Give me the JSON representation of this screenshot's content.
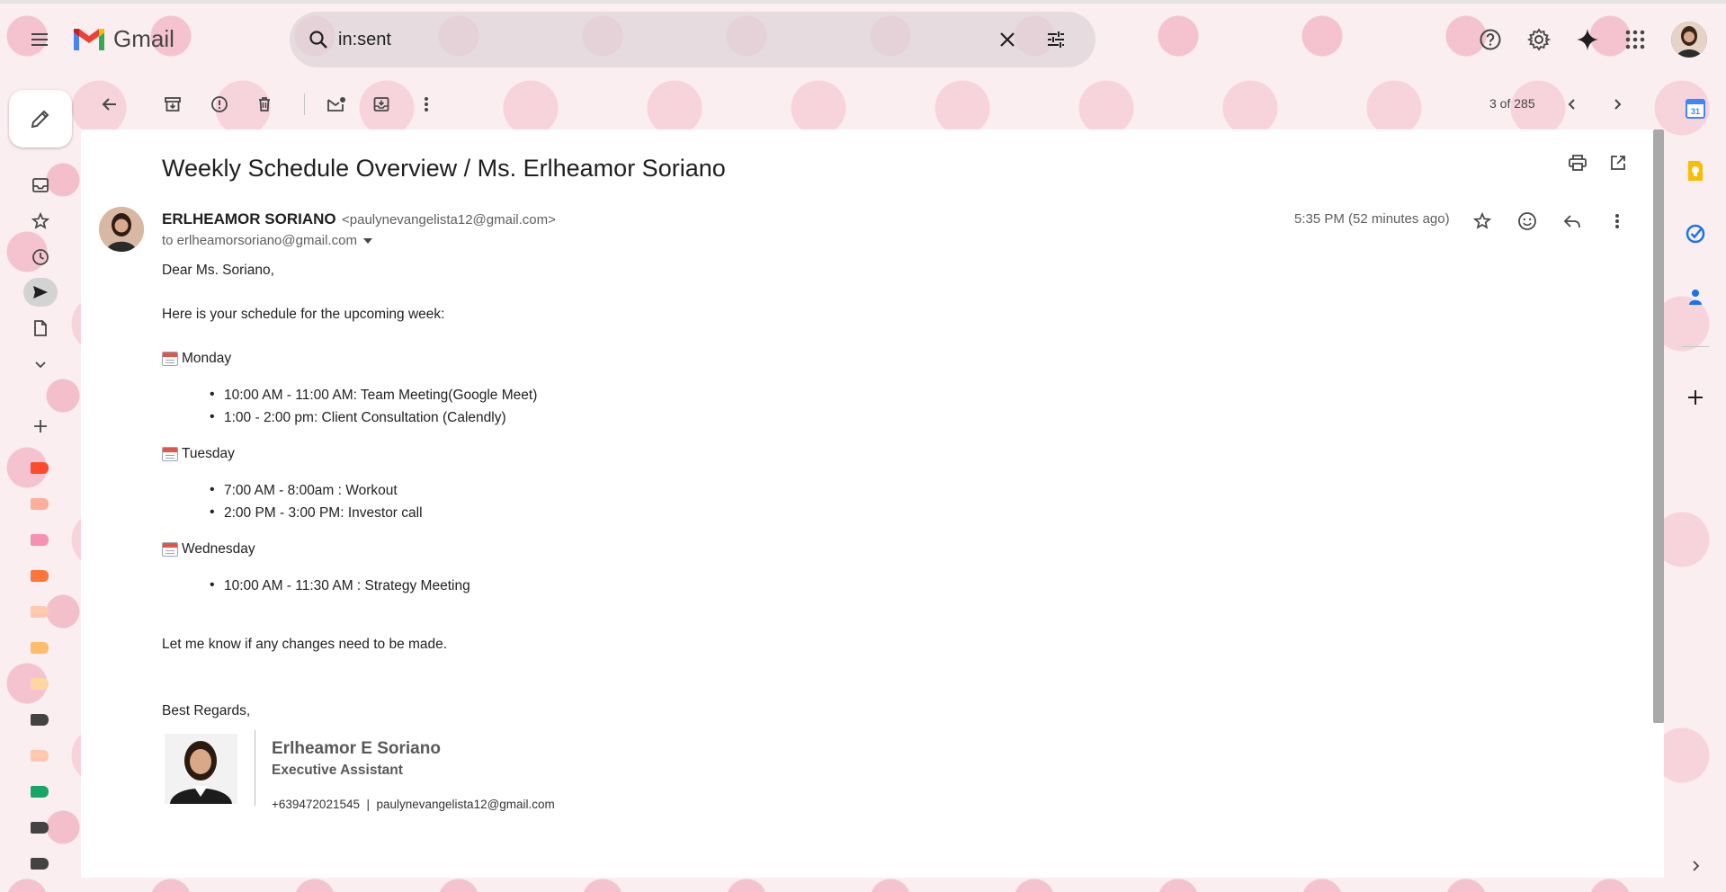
{
  "app": {
    "name": "Gmail"
  },
  "search": {
    "value": "in:sent"
  },
  "header_icons": [
    "menu-icon",
    "search-icon",
    "close-icon",
    "tune-icon",
    "help-icon",
    "settings-icon",
    "gemini-icon",
    "apps-icon"
  ],
  "toolbar": {
    "page_count": "3 of 285"
  },
  "email": {
    "subject": "Weekly Schedule Overview / Ms. Erlheamor Soriano",
    "sender_name": "ERLHEAMOR SORIANO",
    "sender_email": "<paulynevangelista12@gmail.com>",
    "to_line": "to erlheamorsoriano@gmail.com",
    "timestamp": "5:35 PM (52 minutes ago)",
    "greeting": "Dear Ms. Soriano,",
    "intro": "Here is your schedule for the upcoming week:",
    "days": [
      {
        "day": "Monday",
        "items": [
          "10:00 AM - 11:00 AM: Team Meeting(Google Meet)",
          "1:00 - 2:00 pm:  Client Consultation (Calendly)"
        ]
      },
      {
        "day": "Tuesday",
        "items": [
          "7:00 AM - 8:00am : Workout",
          "2:00 PM - 3:00 PM: Investor call"
        ]
      },
      {
        "day": "Wednesday",
        "items": [
          "10:00 AM - 11:30 AM : Strategy Meeting"
        ]
      }
    ],
    "closing_line": "Let me know if any changes need to be made.",
    "signoff": "Best Regards,",
    "signature": {
      "name": "Erlheamor E Soriano",
      "title": "Executive Assistant",
      "contact": "+639472021545  |  paulynevangelista12@gmail.com"
    }
  },
  "colors": {
    "gmail_red": "#ea4335",
    "label_colors": [
      "#fb4c2f",
      "#ffad9b",
      "#f691b3",
      "#ff7537",
      "#ffc8af",
      "#ffbc6b",
      "#ffd6a2",
      "#434343",
      "#ffc8af",
      "#16a766",
      "#434343",
      "#434343"
    ]
  }
}
